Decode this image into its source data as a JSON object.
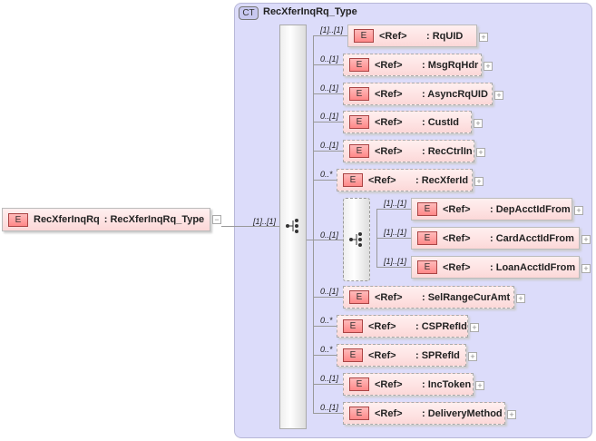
{
  "complex_type": {
    "badge": "CT",
    "name": "RecXferInqRq_Type"
  },
  "root": {
    "badge": "E",
    "name": "RecXferInqRq",
    "type": ": RecXferInqRq_Type",
    "multiplicity": "[1]..[1]"
  },
  "inner_sequence_multiplicity": "0..[1]",
  "elements": [
    {
      "badge": "E",
      "ref": "<Ref>",
      "name": ": RqUID",
      "multiplicity": "[1]..[1]",
      "optional": false
    },
    {
      "badge": "E",
      "ref": "<Ref>",
      "name": ": MsgRqHdr",
      "multiplicity": "0..[1]",
      "optional": true
    },
    {
      "badge": "E",
      "ref": "<Ref>",
      "name": ": AsyncRqUID",
      "multiplicity": "0..[1]",
      "optional": true
    },
    {
      "badge": "E",
      "ref": "<Ref>",
      "name": ": CustId",
      "multiplicity": "0..[1]",
      "optional": true
    },
    {
      "badge": "E",
      "ref": "<Ref>",
      "name": ": RecCtrlIn",
      "multiplicity": "0..[1]",
      "optional": true
    },
    {
      "badge": "E",
      "ref": "<Ref>",
      "name": ": RecXferId",
      "multiplicity": "0..*",
      "optional": true
    },
    {
      "badge": "E",
      "ref": "<Ref>",
      "name": ": DepAcctIdFrom",
      "multiplicity": "[1]..[1]",
      "optional": false
    },
    {
      "badge": "E",
      "ref": "<Ref>",
      "name": ": CardAcctIdFrom",
      "multiplicity": "[1]..[1]",
      "optional": false
    },
    {
      "badge": "E",
      "ref": "<Ref>",
      "name": ": LoanAcctIdFrom",
      "multiplicity": "[1]..[1]",
      "optional": false
    },
    {
      "badge": "E",
      "ref": "<Ref>",
      "name": ": SelRangeCurAmt",
      "multiplicity": "0..[1]",
      "optional": true
    },
    {
      "badge": "E",
      "ref": "<Ref>",
      "name": ": CSPRefId",
      "multiplicity": "0..*",
      "optional": true
    },
    {
      "badge": "E",
      "ref": "<Ref>",
      "name": ": SPRefId",
      "multiplicity": "0..*",
      "optional": true
    },
    {
      "badge": "E",
      "ref": "<Ref>",
      "name": ": IncToken",
      "multiplicity": "0..[1]",
      "optional": true
    },
    {
      "badge": "E",
      "ref": "<Ref>",
      "name": ": DeliveryMethod",
      "multiplicity": "0..[1]",
      "optional": true
    }
  ]
}
